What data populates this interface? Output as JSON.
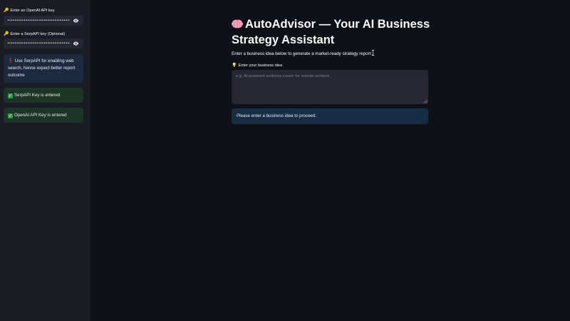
{
  "sidebar": {
    "openai_key": {
      "label": "Enter an OpenAI API key",
      "masked_value": "••••••••••••••••••••••••••••••••••••••••••••••••••••••••••••"
    },
    "serpapi_key": {
      "label": "Enter a SerpAPI key (Optional)",
      "masked_value": "••••••••••••••••••••••••••••••••••••••••••••••••••••••••••••"
    },
    "info_alert": "Use SerpAPI for enabling web search, hence expect better report outcome",
    "serpapi_success": "SerpAPI Key is entered",
    "openai_success": "OpenAI API Key is entered"
  },
  "main": {
    "title": "AutoAdvisor — Your AI Business Strategy Assistant",
    "subtitle": "Enter a business idea below to generate a market-ready strategy report:",
    "input_label": "Enter your business idea",
    "input_placeholder": "e.g. AI-powered wellness coach for remote workers",
    "input_value": "",
    "notice": "Please enter a business idea to proceed."
  },
  "icons": {
    "key": "key-icon",
    "eye": "eye-icon",
    "exclamation": "exclamation-icon",
    "check": "check-icon",
    "brain": "brain-icon",
    "bulb": "lightbulb-icon"
  },
  "colors": {
    "background": "#0e1117",
    "sidebar": "#1a1c24",
    "input": "#262730",
    "info_alert": "#1c2a40",
    "success_alert": "#1d3526",
    "notice": "#172d43",
    "check": "#2ea043",
    "exclamation": "#e5484d"
  }
}
